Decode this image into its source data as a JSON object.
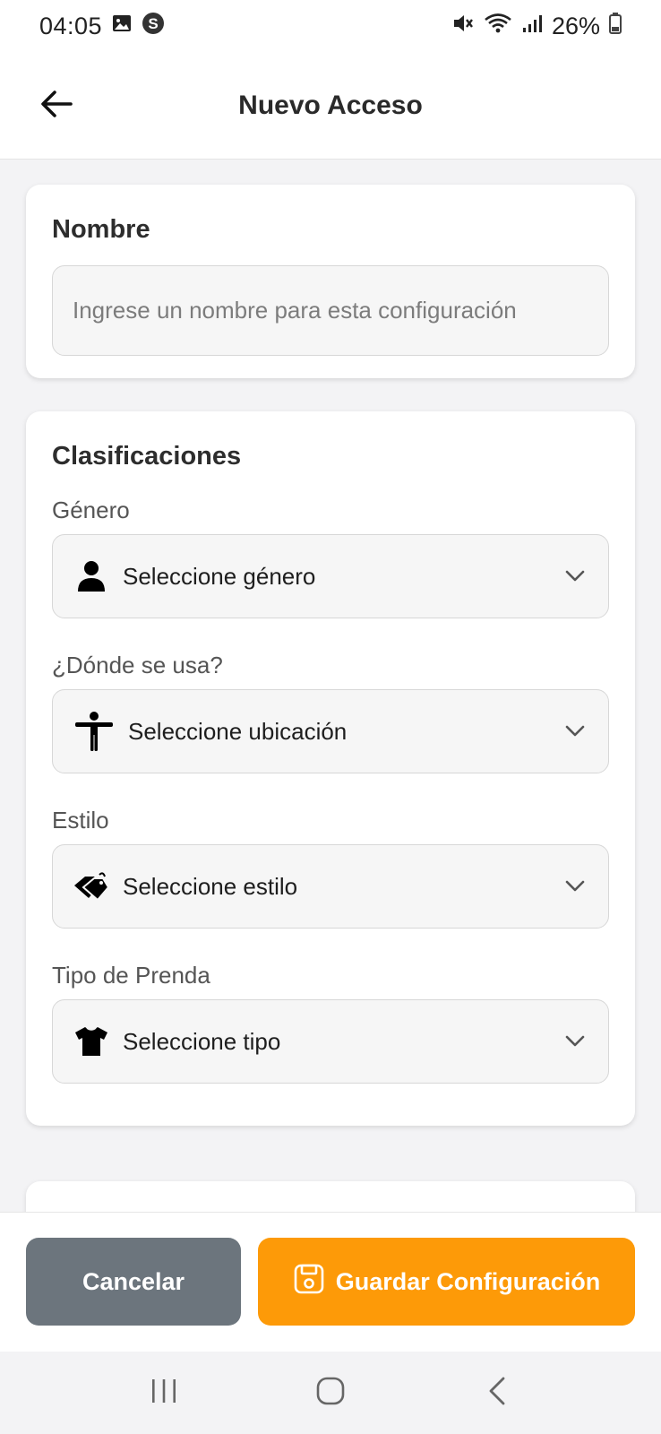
{
  "status_bar": {
    "time": "04:05",
    "battery": "26%",
    "left_icons": [
      "image-icon",
      "s-circle-icon"
    ],
    "right_icons": [
      "mute-icon",
      "wifi-icon",
      "signal-icon",
      "battery-icon"
    ]
  },
  "header": {
    "title": "Nuevo Acceso",
    "back_icon": "arrow-left-icon"
  },
  "name_card": {
    "title": "Nombre",
    "input_value": "",
    "input_placeholder": "Ingrese un nombre para esta configuración"
  },
  "classifications_card": {
    "title": "Clasificaciones",
    "fields": [
      {
        "label": "Género",
        "placeholder": "Seleccione género",
        "icon": "person-icon"
      },
      {
        "label": "¿Dónde se usa?",
        "placeholder": "Seleccione ubicación",
        "icon": "accessibility-icon"
      },
      {
        "label": "Estilo",
        "placeholder": "Seleccione estilo",
        "icon": "tags-icon"
      },
      {
        "label": "Tipo de Prenda",
        "placeholder": "Seleccione tipo",
        "icon": "tshirt-icon"
      }
    ]
  },
  "actions": {
    "cancel_label": "Cancelar",
    "save_label": "Guardar Configuración",
    "save_icon": "save-icon"
  },
  "colors": {
    "accent": "#fd9a08",
    "cancel": "#6c757d"
  },
  "system_nav": {
    "icons": [
      "recents-icon",
      "home-icon",
      "back-nav-icon"
    ]
  }
}
